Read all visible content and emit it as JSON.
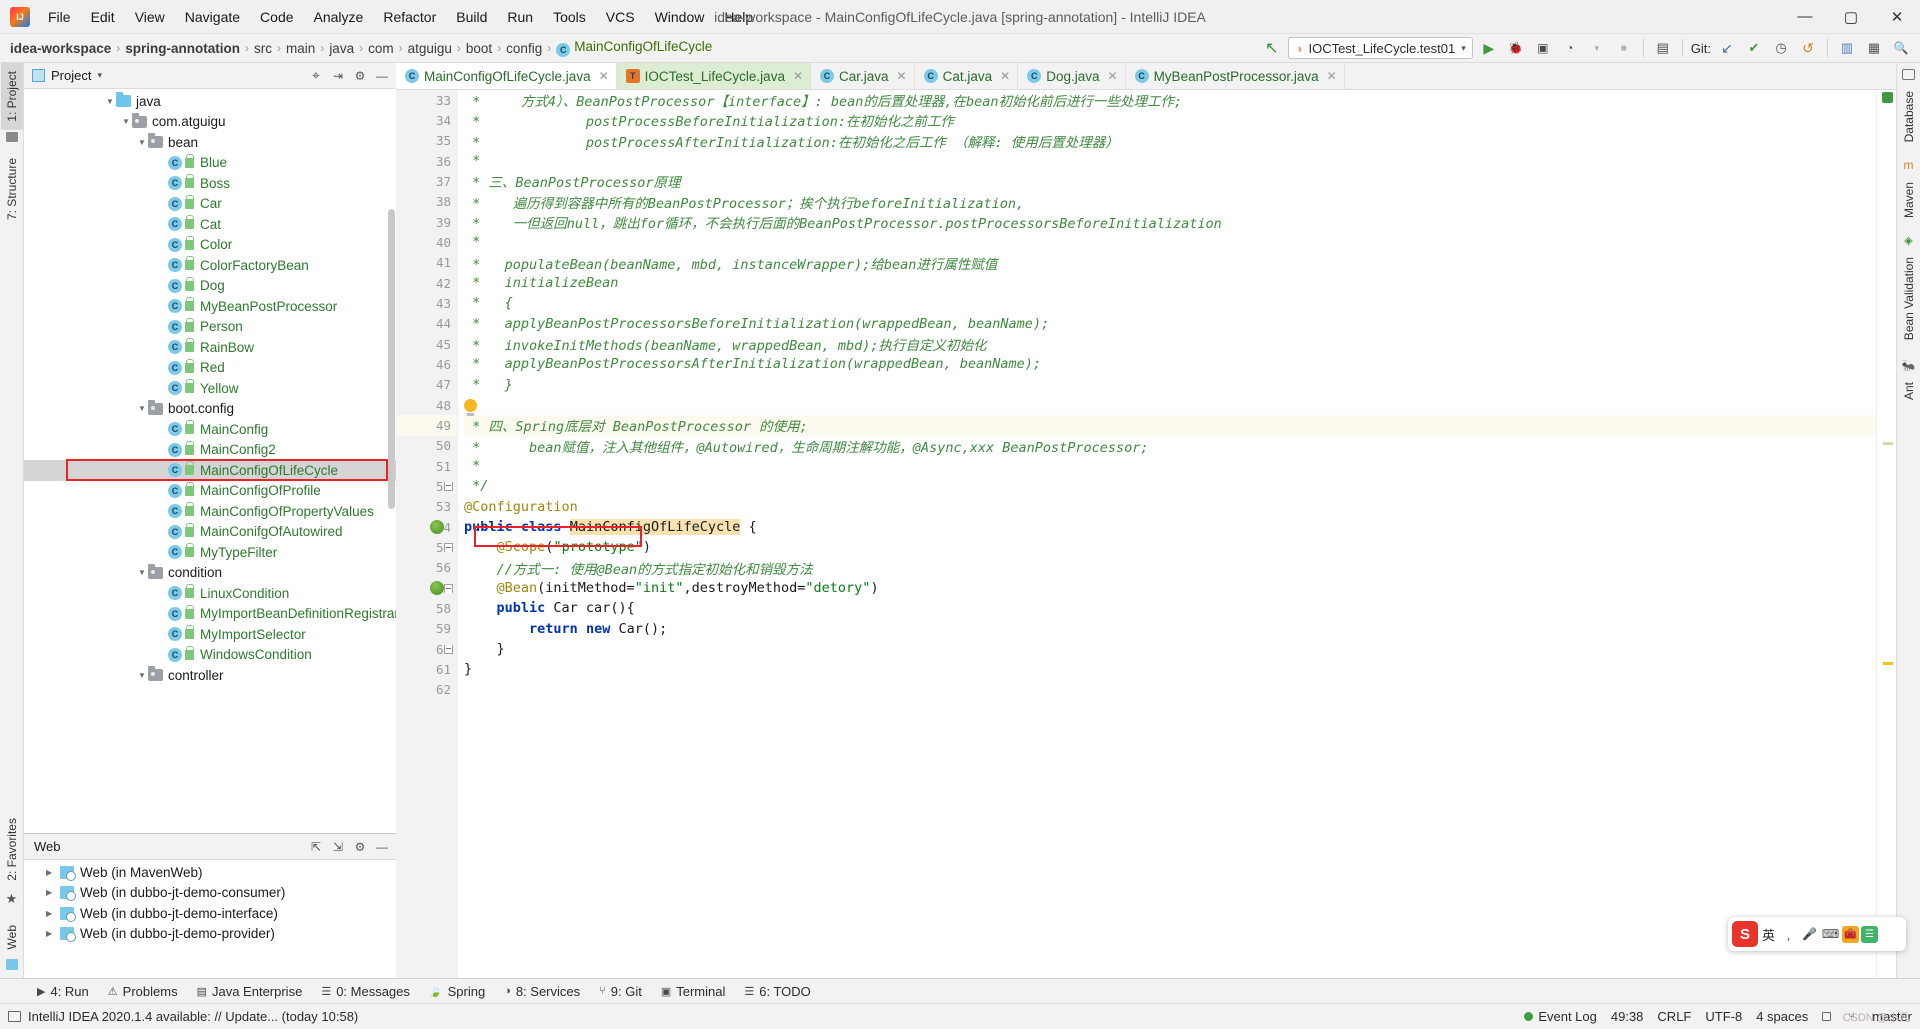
{
  "window": {
    "title": "idea-workspace - MainConfigOfLifeCycle.java [spring-annotation] - IntelliJ IDEA",
    "minimize": "—",
    "maximize": "▢",
    "close": "✕"
  },
  "menubar": {
    "items": [
      "File",
      "Edit",
      "View",
      "Navigate",
      "Code",
      "Analyze",
      "Refactor",
      "Build",
      "Run",
      "Tools",
      "VCS",
      "Window",
      "Help"
    ]
  },
  "breadcrumb": {
    "items": [
      "idea-workspace",
      "spring-annotation",
      "src",
      "main",
      "java",
      "com",
      "atguigu",
      "boot",
      "config"
    ],
    "class_item": "MainConfigOfLifeCycle",
    "class_icon": "C",
    "separator": "›"
  },
  "navbar_right": {
    "back_arrow_icon": "↖",
    "run_config": "IOCTest_LifeCycle.test01",
    "run_config_icon": "◑",
    "dropdown_icon": "▾",
    "run_icon": "▶",
    "debug_icon": "🐞",
    "coverage_icon": "▣",
    "profile_icon": "◔",
    "stop_icon": "■",
    "layout_icon": "▤",
    "git_label": "Git:",
    "git_update_icon": "↙",
    "git_commit_icon": "✔",
    "git_history_icon": "◷",
    "git_revert_icon": "↺",
    "project_struct_icon": "▥",
    "settings_icon": "▦",
    "search_icon": "🔍"
  },
  "left_strip": {
    "project_tab": "1: Project",
    "structure_tab": "7: Structure",
    "favorites_tab": "2: Favorites",
    "web_tab": "Web"
  },
  "right_strip": {
    "database_tab": "Database",
    "maven_tab": "Maven",
    "bean_validation_tab": "Bean Validation",
    "ant_tab": "Ant"
  },
  "project_panel": {
    "title": "Project",
    "dropdown_icon": "▾",
    "locate_icon": "⌖",
    "collapse_icon": "⇥",
    "settings_icon": "⚙",
    "hide_icon": "—",
    "tree": [
      {
        "label": "java",
        "indent": 5,
        "type": "folder-blue",
        "expanded": true
      },
      {
        "label": "com.atguigu",
        "indent": 6,
        "type": "folder",
        "expanded": true
      },
      {
        "label": "bean",
        "indent": 7,
        "type": "folder",
        "expanded": true
      },
      {
        "label": "Blue",
        "indent": 9,
        "type": "class"
      },
      {
        "label": "Boss",
        "indent": 9,
        "type": "class"
      },
      {
        "label": "Car",
        "indent": 9,
        "type": "class"
      },
      {
        "label": "Cat",
        "indent": 9,
        "type": "class"
      },
      {
        "label": "Color",
        "indent": 9,
        "type": "class"
      },
      {
        "label": "ColorFactoryBean",
        "indent": 9,
        "type": "class"
      },
      {
        "label": "Dog",
        "indent": 9,
        "type": "class"
      },
      {
        "label": "MyBeanPostProcessor",
        "indent": 9,
        "type": "class"
      },
      {
        "label": "Person",
        "indent": 9,
        "type": "class"
      },
      {
        "label": "RainBow",
        "indent": 9,
        "type": "class"
      },
      {
        "label": "Red",
        "indent": 9,
        "type": "class"
      },
      {
        "label": "Yellow",
        "indent": 9,
        "type": "class"
      },
      {
        "label": "boot.config",
        "indent": 7,
        "type": "folder",
        "expanded": true
      },
      {
        "label": "MainConfig",
        "indent": 9,
        "type": "class"
      },
      {
        "label": "MainConfig2",
        "indent": 9,
        "type": "class"
      },
      {
        "label": "MainConfigOfLifeCycle",
        "indent": 9,
        "type": "class",
        "selected": true,
        "highlighted": true
      },
      {
        "label": "MainConfigOfProfile",
        "indent": 9,
        "type": "class"
      },
      {
        "label": "MainConfigOfPropertyValues",
        "indent": 9,
        "type": "class"
      },
      {
        "label": "MainConifgOfAutowired",
        "indent": 9,
        "type": "class"
      },
      {
        "label": "MyTypeFilter",
        "indent": 9,
        "type": "class"
      },
      {
        "label": "condition",
        "indent": 7,
        "type": "folder",
        "expanded": true
      },
      {
        "label": "LinuxCondition",
        "indent": 9,
        "type": "class"
      },
      {
        "label": "MyImportBeanDefinitionRegistrar",
        "indent": 9,
        "type": "class"
      },
      {
        "label": "MyImportSelector",
        "indent": 9,
        "type": "class"
      },
      {
        "label": "WindowsCondition",
        "indent": 9,
        "type": "class"
      },
      {
        "label": "controller",
        "indent": 7,
        "type": "folder",
        "expanded": true
      }
    ]
  },
  "web_panel": {
    "title": "Web",
    "expand_icon": "⇱",
    "collapse_icon": "⇲",
    "settings_icon": "⚙",
    "hide_icon": "—",
    "items": [
      "Web (in MavenWeb)",
      "Web (in dubbo-jt-demo-consumer)",
      "Web (in dubbo-jt-demo-interface)",
      "Web (in dubbo-jt-demo-provider)"
    ]
  },
  "editor_tabs": [
    {
      "label": "MainConfigOfLifeCycle.java",
      "icon": "C",
      "active": true,
      "kind": "class"
    },
    {
      "label": "IOCTest_LifeCycle.java",
      "icon": "T",
      "active": false,
      "kind": "test"
    },
    {
      "label": "Car.java",
      "icon": "C",
      "active": false,
      "kind": "class"
    },
    {
      "label": "Cat.java",
      "icon": "C",
      "active": false,
      "kind": "class"
    },
    {
      "label": "Dog.java",
      "icon": "C",
      "active": false,
      "kind": "class"
    },
    {
      "label": "MyBeanPostProcessor.java",
      "icon": "C",
      "active": false,
      "kind": "class"
    }
  ],
  "code": {
    "first_line": 33,
    "lines": [
      {
        "n": 33,
        "segments": [
          {
            "t": " *     方式4）、BeanPostProcessor【interface】: bean的后置处理器,在bean初始化前后进行一些处理工作;",
            "c": "cm"
          }
        ]
      },
      {
        "n": 34,
        "segments": [
          {
            "t": " *             postProcessBeforeInitialization:在初始化之前工作",
            "c": "cm"
          }
        ]
      },
      {
        "n": 35,
        "segments": [
          {
            "t": " *             postProcessAfterInitialization:在初始化之后工作 （解释: 使用后置处理器）",
            "c": "cm"
          }
        ]
      },
      {
        "n": 36,
        "segments": [
          {
            "t": " *",
            "c": "cm"
          }
        ]
      },
      {
        "n": 37,
        "segments": [
          {
            "t": " * 三、BeanPostProcessor原理",
            "c": "cm"
          }
        ]
      },
      {
        "n": 38,
        "segments": [
          {
            "t": " *    遍历得到容器中所有的BeanPostProcessor；挨个执行beforeInitialization,",
            "c": "cm"
          }
        ]
      },
      {
        "n": 39,
        "segments": [
          {
            "t": " *    一但返回null，跳出for循环，不会执行后面的BeanPostProcessor.postProcessorsBeforeInitialization",
            "c": "cm"
          }
        ]
      },
      {
        "n": 40,
        "segments": [
          {
            "t": " *",
            "c": "cm"
          }
        ]
      },
      {
        "n": 41,
        "segments": [
          {
            "t": " *   populateBean(beanName, mbd, instanceWrapper);给bean进行属性赋值",
            "c": "cm"
          }
        ]
      },
      {
        "n": 42,
        "segments": [
          {
            "t": " *   initializeBean",
            "c": "cm"
          }
        ]
      },
      {
        "n": 43,
        "segments": [
          {
            "t": " *   {",
            "c": "cm"
          }
        ]
      },
      {
        "n": 44,
        "segments": [
          {
            "t": " *   applyBeanPostProcessorsBeforeInitialization(wrappedBean, beanName);",
            "c": "cm"
          }
        ]
      },
      {
        "n": 45,
        "segments": [
          {
            "t": " *   invokeInitMethods(beanName, wrappedBean, mbd);执行自定义初始化",
            "c": "cm"
          }
        ]
      },
      {
        "n": 46,
        "segments": [
          {
            "t": " *   applyBeanPostProcessorsAfterInitialization(wrappedBean, beanName);",
            "c": "cm"
          }
        ]
      },
      {
        "n": 47,
        "segments": [
          {
            "t": " *   }",
            "c": "cm"
          }
        ]
      },
      {
        "n": 48,
        "segments": [],
        "bulb": true
      },
      {
        "n": 49,
        "segments": [
          {
            "t": " * 四、Spring底层对 BeanPostProcessor 的使用;",
            "c": "cm"
          }
        ],
        "caret": true
      },
      {
        "n": 50,
        "segments": [
          {
            "t": " *      bean赋值，注入其他组件，@Autowired，生命周期注解功能，@Async,xxx BeanPostProcessor;",
            "c": "cm"
          }
        ]
      },
      {
        "n": 51,
        "segments": [
          {
            "t": " *",
            "c": "cm"
          }
        ]
      },
      {
        "n": 52,
        "segments": [
          {
            "t": " */",
            "c": "cm"
          }
        ],
        "fold": "bot"
      },
      {
        "n": 53,
        "segments": [
          {
            "t": "@Configuration",
            "c": "ann"
          }
        ]
      },
      {
        "n": 54,
        "segments": [
          {
            "t": "public ",
            "c": "kw"
          },
          {
            "t": "class ",
            "c": "kw"
          },
          {
            "t": "MainConfigOfLifeCycle",
            "c": "hl-sym"
          },
          {
            "t": " {",
            "c": "plain"
          }
        ],
        "spring": true
      },
      {
        "n": 55,
        "segments": [
          {
            "t": "    ",
            "c": "plain"
          },
          {
            "t": "@Scope",
            "c": "ann"
          },
          {
            "t": "(",
            "c": "plain"
          },
          {
            "t": "\"prototype\"",
            "c": "str"
          },
          {
            "t": ")",
            "c": "plain"
          }
        ],
        "fold": "top"
      },
      {
        "n": 56,
        "segments": [
          {
            "t": "    //方式一: 使用@Bean的方式指定初始化和销毁方法",
            "c": "cm"
          }
        ]
      },
      {
        "n": 57,
        "segments": [
          {
            "t": "    ",
            "c": "plain"
          },
          {
            "t": "@Bean",
            "c": "ann"
          },
          {
            "t": "(initMethod=",
            "c": "plain"
          },
          {
            "t": "\"init\"",
            "c": "str"
          },
          {
            "t": ",destroyMethod=",
            "c": "plain"
          },
          {
            "t": "\"detory\"",
            "c": "str"
          },
          {
            "t": ")",
            "c": "plain"
          }
        ],
        "spring": true,
        "fold": "top"
      },
      {
        "n": 58,
        "segments": [
          {
            "t": "    ",
            "c": "plain"
          },
          {
            "t": "public ",
            "c": "kw"
          },
          {
            "t": "Car car(){",
            "c": "plain"
          }
        ]
      },
      {
        "n": 59,
        "segments": [
          {
            "t": "        ",
            "c": "plain"
          },
          {
            "t": "return ",
            "c": "kw"
          },
          {
            "t": "",
            "c": "plain"
          },
          {
            "t": "new ",
            "c": "kw"
          },
          {
            "t": "Car();",
            "c": "plain"
          }
        ]
      },
      {
        "n": 60,
        "segments": [
          {
            "t": "    }",
            "c": "plain"
          }
        ],
        "fold": "bot"
      },
      {
        "n": 61,
        "segments": [
          {
            "t": "}",
            "c": "plain"
          }
        ]
      },
      {
        "n": 62,
        "segments": []
      }
    ]
  },
  "ime": {
    "logo": "S",
    "mode_label": "英",
    "comma_icon": "﹐",
    "mic_icon": "🎤",
    "keyboard_icon": "⌨",
    "toolbox_icon": "🧰",
    "menu_icon": "☰"
  },
  "tool_windows": [
    {
      "label": "4: Run",
      "icon": "▶",
      "underline": "4"
    },
    {
      "label": "Problems",
      "icon": "⚠",
      "underline": ""
    },
    {
      "label": "Java Enterprise",
      "icon": "▤",
      "underline": ""
    },
    {
      "label": "0: Messages",
      "icon": "☰",
      "underline": "0"
    },
    {
      "label": "Spring",
      "icon": "🍃",
      "underline": ""
    },
    {
      "label": "8: Services",
      "icon": "◑",
      "underline": "8"
    },
    {
      "label": "9: Git",
      "icon": "⑂",
      "underline": "9"
    },
    {
      "label": "Terminal",
      "icon": "▣",
      "underline": ""
    },
    {
      "label": "6: TODO",
      "icon": "☰",
      "underline": "6"
    }
  ],
  "statusbar": {
    "message": "IntelliJ IDEA 2020.1.4 available: // Update... (today 10:58)",
    "caret_position": "49:38",
    "line_separator": "CRLF",
    "encoding": "UTF-8",
    "indent": "4 spaces",
    "branch": "master",
    "event_log": "Event Log",
    "lock_icon": "🔒"
  },
  "watermark": "CSDN @小凡",
  "colors": {
    "accent_green": "#2d7a2d",
    "comment_green": "#3f8a3f",
    "keyword_blue": "#0033b3",
    "annotation_yellow": "#9e880d",
    "string_green": "#067d17",
    "highlight_red": "#e8242a",
    "caret_line": "#fcfaef",
    "selection_gray": "#d4d4d4"
  }
}
